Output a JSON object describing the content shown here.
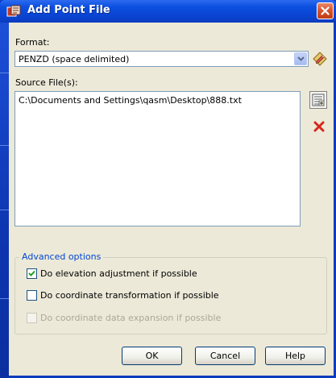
{
  "window": {
    "title": "Add Point File"
  },
  "format": {
    "label": "Format:",
    "selected": "PENZD (space delimited)"
  },
  "source": {
    "label": "Source File(s):",
    "files": [
      "C:\\Documents and Settings\\qasm\\Desktop\\888.txt"
    ]
  },
  "advanced": {
    "legend": "Advanced options",
    "options": [
      {
        "label": "Do elevation adjustment if possible",
        "checked": true,
        "enabled": true
      },
      {
        "label": "Do coordinate transformation if possible",
        "checked": false,
        "enabled": true
      },
      {
        "label": "Do coordinate data expansion if possible",
        "checked": false,
        "enabled": false
      }
    ]
  },
  "buttons": {
    "ok": "OK",
    "cancel": "Cancel",
    "help": "Help"
  },
  "colors": {
    "titlebar": "#0a44d2",
    "dialog_bg": "#ece9d8",
    "legend": "#0046d5",
    "close": "#d5512a"
  }
}
